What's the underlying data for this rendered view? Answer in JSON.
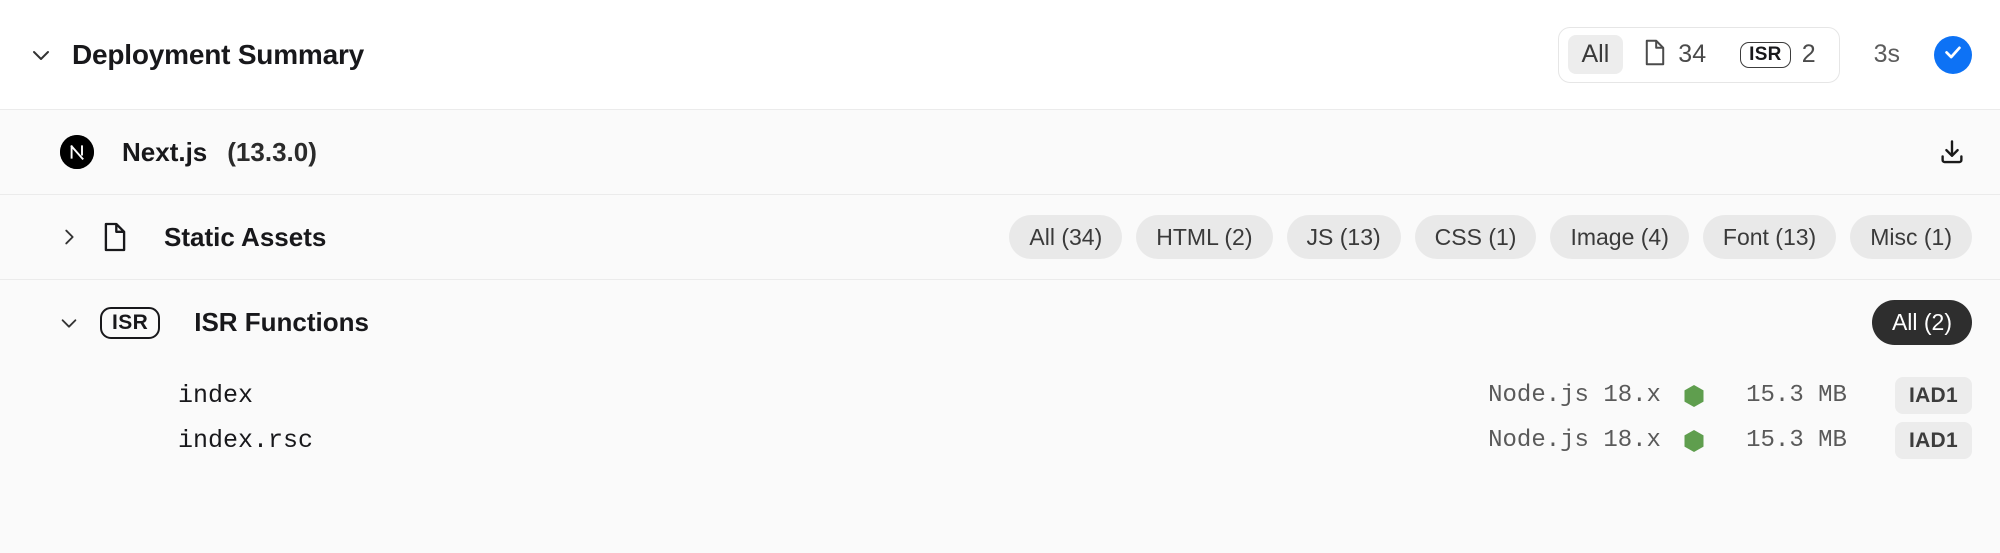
{
  "header": {
    "title": "Deployment Summary",
    "collapse_icon": "chevron-down-icon",
    "filters": {
      "all_label": "All",
      "static_icon": "file-icon",
      "static_count": "34",
      "isr_badge_label": "ISR",
      "isr_count": "2"
    },
    "duration": "3s",
    "status_icon": "check-icon",
    "status_color": "#0d72f5"
  },
  "framework": {
    "logo_icon": "nextjs-logo-icon",
    "name": "Next.js",
    "version": "(13.3.0)",
    "download_icon": "download-icon"
  },
  "sections": [
    {
      "id": "static-assets",
      "chevron_icon": "chevron-right-icon",
      "icon": "file-icon",
      "title": "Static Assets",
      "expanded": false,
      "pills": [
        {
          "label": "All (34)",
          "dark": false
        },
        {
          "label": "HTML (2)",
          "dark": false
        },
        {
          "label": "JS (13)",
          "dark": false
        },
        {
          "label": "CSS (1)",
          "dark": false
        },
        {
          "label": "Image (4)",
          "dark": false
        },
        {
          "label": "Font (13)",
          "dark": false
        },
        {
          "label": "Misc (1)",
          "dark": false
        }
      ]
    },
    {
      "id": "isr-functions",
      "chevron_icon": "chevron-down-icon",
      "icon": "isr-badge-icon",
      "icon_label": "ISR",
      "title": "ISR Functions",
      "expanded": true,
      "pills": [
        {
          "label": "All (2)",
          "dark": true
        }
      ]
    }
  ],
  "functions": [
    {
      "name": "index",
      "runtime": "Node.js 18.x",
      "runtime_icon": "nodejs-hexagon-icon",
      "size": "15.3 MB",
      "region": "IAD1"
    },
    {
      "name": "index.rsc",
      "runtime": "Node.js 18.x",
      "runtime_icon": "nodejs-hexagon-icon",
      "size": "15.3 MB",
      "region": "IAD1"
    }
  ],
  "colors": {
    "accent": "#0d72f5",
    "node_green": "#5f9e4e",
    "pill_bg": "#e9e9e9",
    "pill_dark_bg": "#2e2e2e",
    "page_bg": "#fafafa",
    "border": "#ebebeb"
  }
}
